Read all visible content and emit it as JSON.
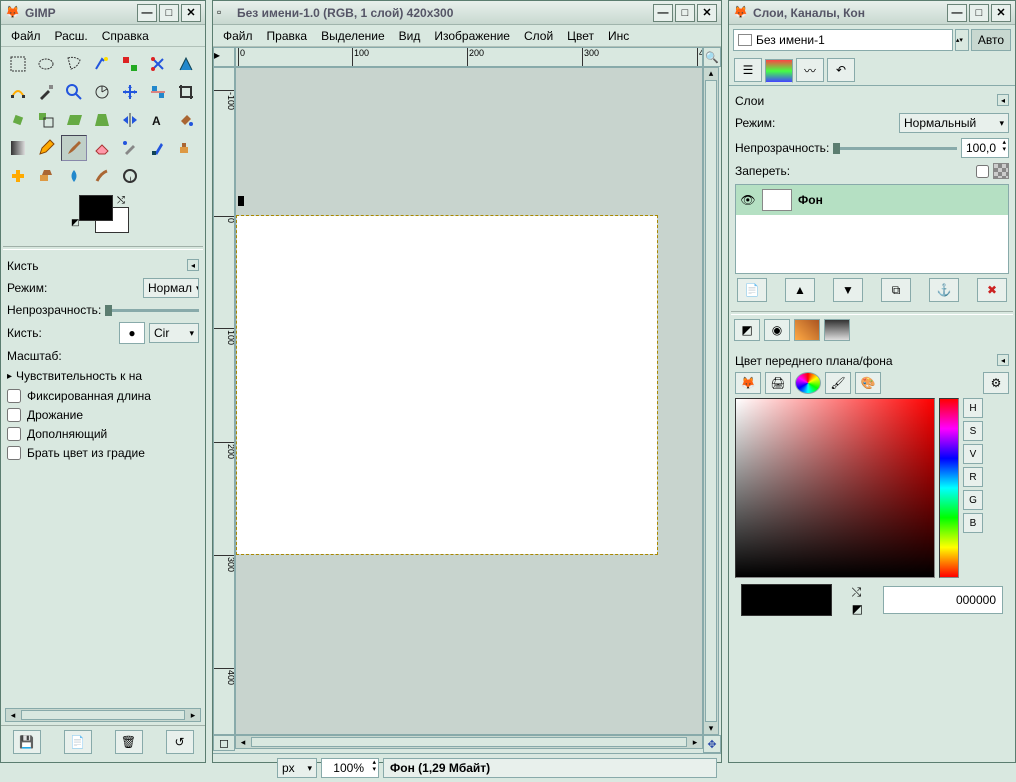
{
  "toolbox": {
    "title": "GIMP",
    "menus": [
      "Файл",
      "Расш.",
      "Справка"
    ],
    "opts_title": "Кисть",
    "mode_label": "Режим:",
    "mode_value": "Нормал",
    "opacity_label": "Непрозрачность:",
    "brush_label": "Кисть:",
    "brush_value": "Cir",
    "scale_label": "Масштаб:",
    "sensitivity": "Чувствительность к на",
    "checks": [
      "Фиксированная длина",
      "Дрожание",
      "Дополняющий",
      "Брать цвет из градие"
    ]
  },
  "image": {
    "title": "Без имени-1.0 (RGB, 1 слой) 420x300",
    "menus": [
      "Файл",
      "Правка",
      "Выделение",
      "Вид",
      "Изображение",
      "Слой",
      "Цвет",
      "Инс"
    ],
    "unit": "px",
    "zoom": "100%",
    "status": "Фон (1,29 Мбайт)",
    "ruler_h": [
      "0",
      "100",
      "200",
      "300",
      "4"
    ],
    "ruler_v": [
      "-100",
      "0",
      "100",
      "200",
      "300",
      "400"
    ]
  },
  "layers": {
    "title": "Слои, Каналы, Кон",
    "image_name": "Без имени-1",
    "auto": "Авто",
    "panel_title": "Слои",
    "mode_label": "Режим:",
    "mode_value": "Нормальный",
    "opacity_label": "Непрозрачность:",
    "opacity_value": "100,0",
    "lock_label": "Запереть:",
    "layer_name": "Фон",
    "fg_title": "Цвет переднего плана/фона",
    "hex": "000000",
    "components": [
      "H",
      "S",
      "V",
      "R",
      "G",
      "B"
    ]
  }
}
